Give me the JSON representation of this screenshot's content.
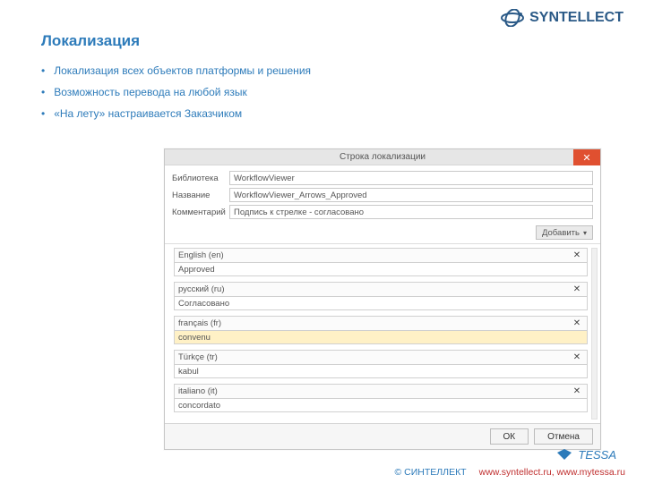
{
  "brand_top": "SYNTELLECT",
  "title": "Локализация",
  "bullets": [
    "Локализация всех объектов платформы и решения",
    "Возможность перевода на любой язык",
    "«На лету» настраивается Заказчиком"
  ],
  "dialog": {
    "title": "Строка локализации",
    "labels": {
      "library": "Библиотека",
      "name": "Название",
      "comment": "Комментарий"
    },
    "fields": {
      "library": "WorkflowViewer",
      "name": "WorkflowViewer_Arrows_Approved",
      "comment": "Подпись к стрелке - согласовано"
    },
    "add_label": "Добавить",
    "langs": [
      {
        "lang": "English (en)",
        "value": "Approved",
        "highlight": false
      },
      {
        "lang": "русский (ru)",
        "value": "Согласовано",
        "highlight": false
      },
      {
        "lang": "français (fr)",
        "value": "convenu",
        "highlight": true
      },
      {
        "lang": "Türkçe (tr)",
        "value": "kabul",
        "highlight": false
      },
      {
        "lang": "italiano (it)",
        "value": "concordato",
        "highlight": false
      }
    ],
    "buttons": {
      "ok": "ОК",
      "cancel": "Отмена"
    }
  },
  "footer": {
    "tessa": "TESSA",
    "copyright": "© СИНТЕЛЛЕКТ",
    "urls": "www.syntellect.ru, www.mytessa.ru"
  }
}
